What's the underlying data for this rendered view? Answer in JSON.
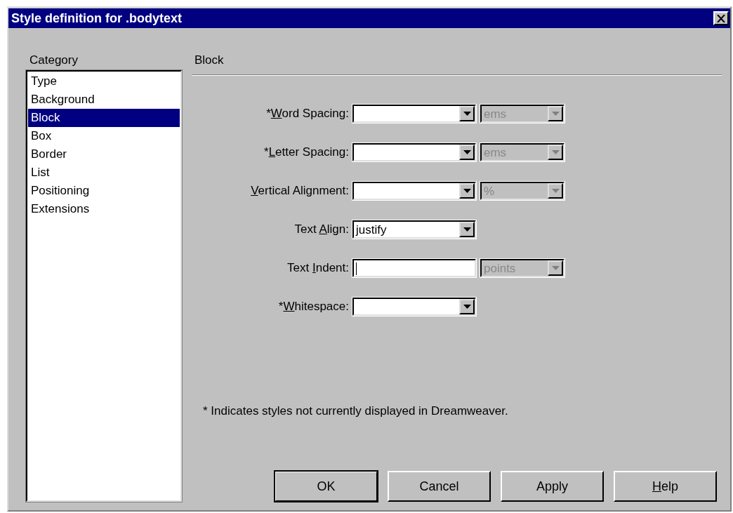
{
  "window": {
    "title": "Style definition for .bodytext"
  },
  "category": {
    "heading": "Category",
    "items": [
      {
        "label": "Type",
        "selected": false
      },
      {
        "label": "Background",
        "selected": false
      },
      {
        "label": "Block",
        "selected": true
      },
      {
        "label": "Box",
        "selected": false
      },
      {
        "label": "Border",
        "selected": false
      },
      {
        "label": "List",
        "selected": false
      },
      {
        "label": "Positioning",
        "selected": false
      },
      {
        "label": "Extensions",
        "selected": false
      }
    ]
  },
  "panel": {
    "heading": "Block",
    "rows": [
      {
        "label": {
          "before": "*",
          "key": "W",
          "after": "ord Spacing:"
        },
        "field": {
          "kind": "combo"
        },
        "unit": {
          "value": "ems",
          "disabled": true
        }
      },
      {
        "label": {
          "before": "*",
          "key": "L",
          "after": "etter Spacing:"
        },
        "field": {
          "kind": "combo"
        },
        "unit": {
          "value": "ems",
          "disabled": true
        }
      },
      {
        "label": {
          "key": "V",
          "after": "ertical Alignment:"
        },
        "field": {
          "kind": "combo"
        },
        "unit": {
          "value": "%",
          "disabled": true
        }
      },
      {
        "label": {
          "before": "Text ",
          "key": "A",
          "after": "lign:"
        },
        "field": {
          "kind": "combo",
          "value": "justify"
        }
      },
      {
        "label": {
          "before": "Text ",
          "key": "I",
          "after": "ndent:"
        },
        "field": {
          "kind": "text",
          "focused": true
        },
        "unit": {
          "value": "points",
          "disabled": true
        }
      },
      {
        "label": {
          "before": "*",
          "key": "W",
          "after": "hitespace:"
        },
        "field": {
          "kind": "combo"
        }
      }
    ],
    "note": "* Indicates styles not currently displayed in Dreamweaver."
  },
  "buttons": [
    {
      "label": {
        "before": "OK"
      },
      "default": true
    },
    {
      "label": {
        "before": "Cancel"
      },
      "default": false
    },
    {
      "label": {
        "before": "Apply"
      },
      "default": false
    },
    {
      "label": {
        "key": "H",
        "after": "elp"
      },
      "default": false
    }
  ]
}
